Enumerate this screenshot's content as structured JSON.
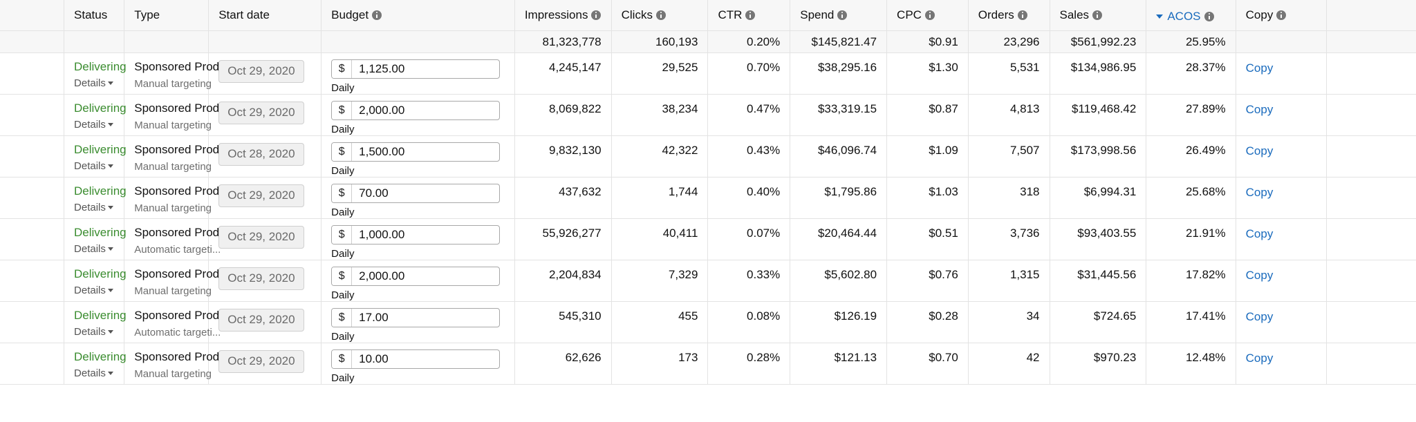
{
  "table": {
    "columns": [
      {
        "key": "spacer",
        "label": "",
        "align": "left",
        "info": false,
        "sorted": false
      },
      {
        "key": "status",
        "label": "Status",
        "align": "left",
        "info": false,
        "sorted": false
      },
      {
        "key": "type",
        "label": "Type",
        "align": "left",
        "info": false,
        "sorted": false
      },
      {
        "key": "start",
        "label": "Start date",
        "align": "left",
        "info": false,
        "sorted": false
      },
      {
        "key": "budget",
        "label": "Budget",
        "align": "left",
        "info": true,
        "sorted": false
      },
      {
        "key": "impr",
        "label": "Impressions",
        "align": "left",
        "info": true,
        "sorted": false
      },
      {
        "key": "clicks",
        "label": "Clicks",
        "align": "left",
        "info": true,
        "sorted": false
      },
      {
        "key": "ctr",
        "label": "CTR",
        "align": "left",
        "info": true,
        "sorted": false
      },
      {
        "key": "spend",
        "label": "Spend",
        "align": "left",
        "info": true,
        "sorted": false
      },
      {
        "key": "cpc",
        "label": "CPC",
        "align": "left",
        "info": true,
        "sorted": false
      },
      {
        "key": "orders",
        "label": "Orders",
        "align": "left",
        "info": true,
        "sorted": false
      },
      {
        "key": "sales",
        "label": "Sales",
        "align": "left",
        "info": true,
        "sorted": false
      },
      {
        "key": "acos",
        "label": "ACOS",
        "align": "left",
        "info": true,
        "sorted": true
      },
      {
        "key": "copy",
        "label": "Copy",
        "align": "left",
        "info": true,
        "sorted": false
      },
      {
        "key": "end",
        "label": "",
        "align": "left",
        "info": false,
        "sorted": false
      }
    ],
    "sort": {
      "column": "ACOS",
      "direction": "descending"
    },
    "summary": {
      "impressions": "81,323,778",
      "clicks": "160,193",
      "ctr": "0.20%",
      "spend": "$145,821.47",
      "cpc": "$0.91",
      "orders": "23,296",
      "sales": "$561,992.23",
      "acos": "25.95%"
    },
    "labels": {
      "details": "Details",
      "budget_currency_symbol": "$",
      "budget_period": "Daily",
      "copy": "Copy"
    },
    "rows": [
      {
        "status": "Delivering",
        "type": "Sponsored Prod...",
        "targeting": "Manual targeting",
        "start_date": "Oct 29, 2020",
        "budget": "1,125.00",
        "budget_period": "Daily",
        "impressions": "4,245,147",
        "clicks": "29,525",
        "ctr": "0.70%",
        "spend": "$38,295.16",
        "cpc": "$1.30",
        "orders": "5,531",
        "sales": "$134,986.95",
        "acos": "28.37%",
        "copy": "Copy"
      },
      {
        "status": "Delivering",
        "type": "Sponsored Prod...",
        "targeting": "Manual targeting",
        "start_date": "Oct 29, 2020",
        "budget": "2,000.00",
        "budget_period": "Daily",
        "impressions": "8,069,822",
        "clicks": "38,234",
        "ctr": "0.47%",
        "spend": "$33,319.15",
        "cpc": "$0.87",
        "orders": "4,813",
        "sales": "$119,468.42",
        "acos": "27.89%",
        "copy": "Copy"
      },
      {
        "status": "Delivering",
        "type": "Sponsored Prod...",
        "targeting": "Manual targeting",
        "start_date": "Oct 28, 2020",
        "budget": "1,500.00",
        "budget_period": "Daily",
        "impressions": "9,832,130",
        "clicks": "42,322",
        "ctr": "0.43%",
        "spend": "$46,096.74",
        "cpc": "$1.09",
        "orders": "7,507",
        "sales": "$173,998.56",
        "acos": "26.49%",
        "copy": "Copy"
      },
      {
        "status": "Delivering",
        "type": "Sponsored Prod...",
        "targeting": "Manual targeting",
        "start_date": "Oct 29, 2020",
        "budget": "70.00",
        "budget_period": "Daily",
        "impressions": "437,632",
        "clicks": "1,744",
        "ctr": "0.40%",
        "spend": "$1,795.86",
        "cpc": "$1.03",
        "orders": "318",
        "sales": "$6,994.31",
        "acos": "25.68%",
        "copy": "Copy"
      },
      {
        "status": "Delivering",
        "type": "Sponsored Prod...",
        "targeting": "Automatic targeti...",
        "start_date": "Oct 29, 2020",
        "budget": "1,000.00",
        "budget_period": "Daily",
        "impressions": "55,926,277",
        "clicks": "40,411",
        "ctr": "0.07%",
        "spend": "$20,464.44",
        "cpc": "$0.51",
        "orders": "3,736",
        "sales": "$93,403.55",
        "acos": "21.91%",
        "copy": "Copy"
      },
      {
        "status": "Delivering",
        "type": "Sponsored Prod...",
        "targeting": "Manual targeting",
        "start_date": "Oct 29, 2020",
        "budget": "2,000.00",
        "budget_period": "Daily",
        "impressions": "2,204,834",
        "clicks": "7,329",
        "ctr": "0.33%",
        "spend": "$5,602.80",
        "cpc": "$0.76",
        "orders": "1,315",
        "sales": "$31,445.56",
        "acos": "17.82%",
        "copy": "Copy"
      },
      {
        "status": "Delivering",
        "type": "Sponsored Prod...",
        "targeting": "Automatic targeti...",
        "start_date": "Oct 29, 2020",
        "budget": "17.00",
        "budget_period": "Daily",
        "impressions": "545,310",
        "clicks": "455",
        "ctr": "0.08%",
        "spend": "$126.19",
        "cpc": "$0.28",
        "orders": "34",
        "sales": "$724.65",
        "acos": "17.41%",
        "copy": "Copy"
      },
      {
        "status": "Delivering",
        "type": "Sponsored Prod...",
        "targeting": "Manual targeting",
        "start_date": "Oct 29, 2020",
        "budget": "10.00",
        "budget_period": "Daily",
        "impressions": "62,626",
        "clicks": "173",
        "ctr": "0.28%",
        "spend": "$121.13",
        "cpc": "$0.70",
        "orders": "42",
        "sales": "$970.23",
        "acos": "12.48%",
        "copy": "Copy"
      }
    ]
  },
  "colors": {
    "status_green": "#3a8c2f",
    "link_blue": "#1a6bbd",
    "header_bg": "#f7f7f7",
    "border": "#e3e3e3"
  }
}
